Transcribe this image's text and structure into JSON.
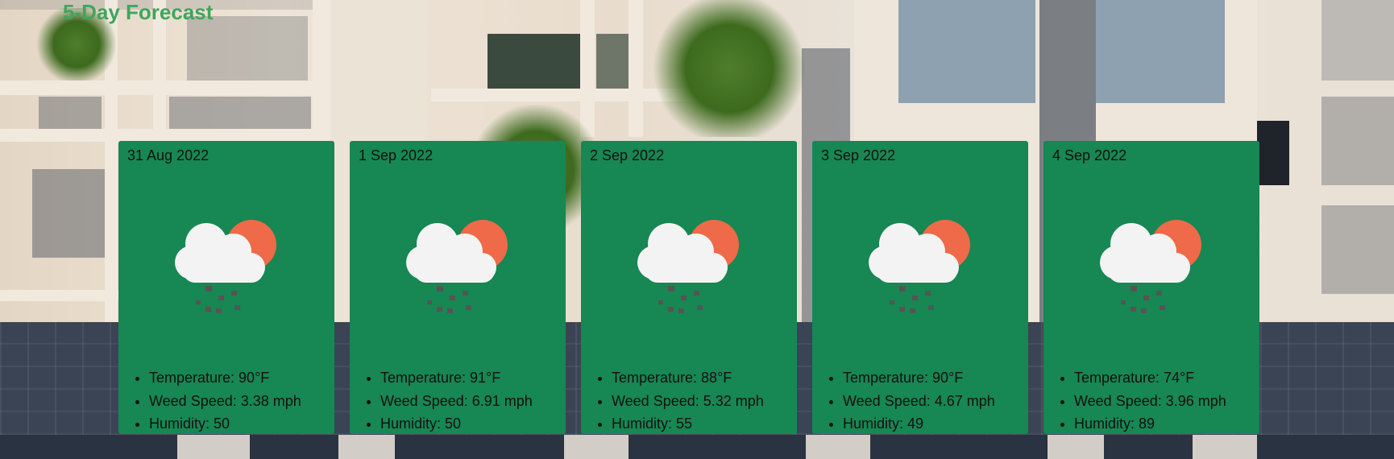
{
  "page": {
    "title": "5-Day Forecast"
  },
  "forecast": [
    {
      "date": "31 Aug 2022",
      "icon": "cloud-sun-rain-icon",
      "temperature": "Temperature: 90°F",
      "wind": "Weed Speed: 3.38 mph",
      "humidity": "Humidity: 50"
    },
    {
      "date": "1 Sep 2022",
      "icon": "cloud-sun-rain-icon",
      "temperature": "Temperature: 91°F",
      "wind": "Weed Speed: 6.91 mph",
      "humidity": "Humidity: 50"
    },
    {
      "date": "2 Sep 2022",
      "icon": "cloud-sun-rain-icon",
      "temperature": "Temperature: 88°F",
      "wind": "Weed Speed: 5.32 mph",
      "humidity": "Humidity: 55"
    },
    {
      "date": "3 Sep 2022",
      "icon": "cloud-sun-rain-icon",
      "temperature": "Temperature: 90°F",
      "wind": "Weed Speed: 4.67 mph",
      "humidity": "Humidity: 49"
    },
    {
      "date": "4 Sep 2022",
      "icon": "cloud-sun-rain-icon",
      "temperature": "Temperature: 74°F",
      "wind": "Weed Speed: 3.96 mph",
      "humidity": "Humidity: 89"
    }
  ],
  "colors": {
    "card_background": "#178753",
    "title_color": "#3fa55f",
    "sun": "#ee6a48",
    "cloud": "#f3f3f3",
    "rain": "#555555"
  }
}
